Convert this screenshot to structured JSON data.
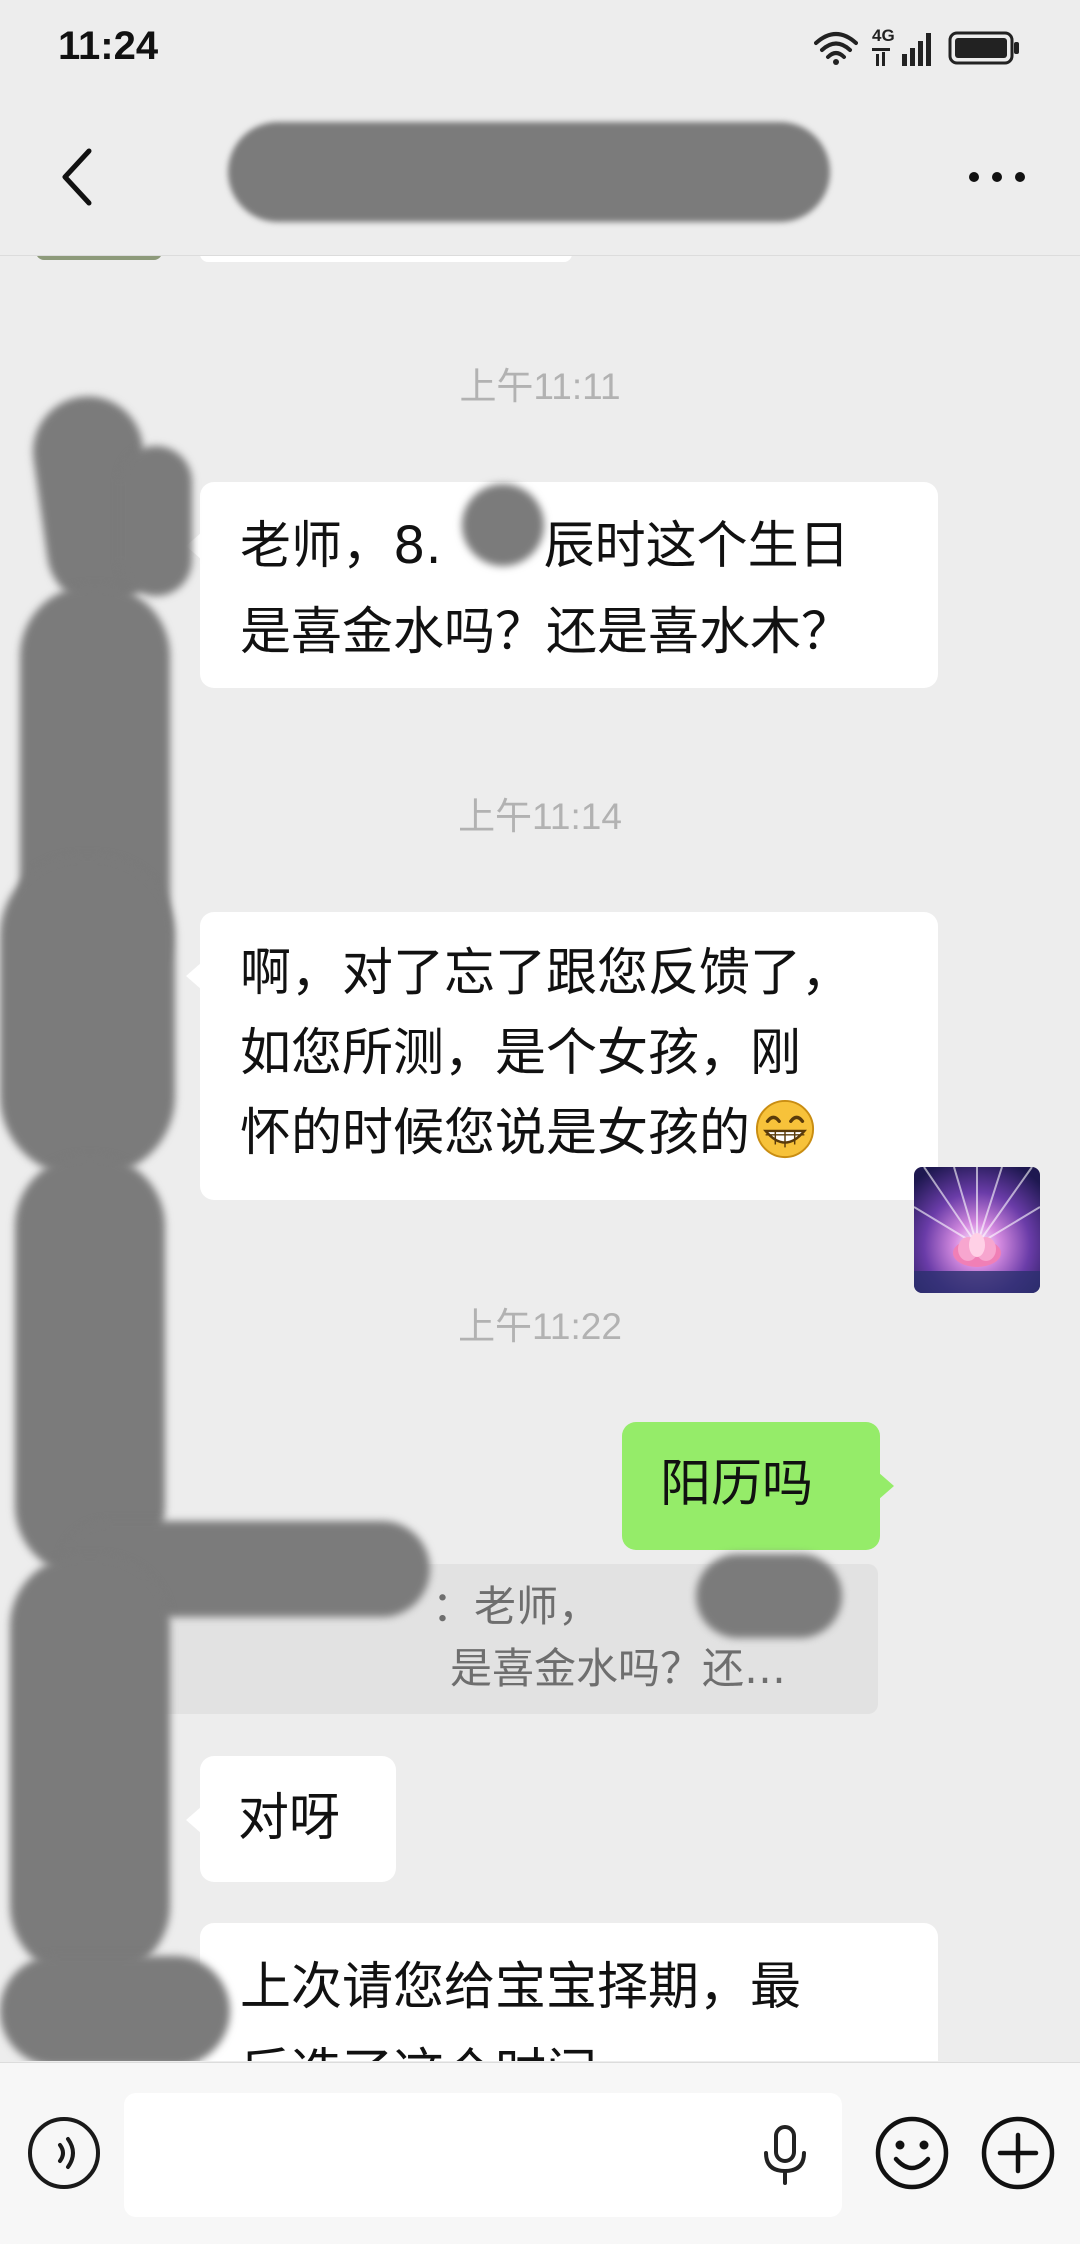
{
  "status_bar": {
    "time": "11:24",
    "network": "4G",
    "icons": [
      "wifi-icon",
      "signal-icon",
      "battery-icon"
    ]
  },
  "nav": {
    "back_icon": "chevron-left-icon",
    "more_icon": "more-dots-icon"
  },
  "messages": [
    {
      "kind": "timestamp",
      "text": "上午11:11"
    },
    {
      "kind": "incoming",
      "lines": [
        "老师，8.　　辰时这个生日",
        "是喜金水吗？还是喜水木？"
      ]
    },
    {
      "kind": "timestamp",
      "text": "上午11:14"
    },
    {
      "kind": "incoming",
      "lines": [
        "啊，对了忘了跟您反馈了，",
        "如您所测，是个女孩，刚",
        "怀的时候您说是女孩的"
      ],
      "emoji": "grinning-face-emoji"
    },
    {
      "kind": "timestamp",
      "text": "上午11:22"
    },
    {
      "kind": "outgoing",
      "text": "阳历吗"
    },
    {
      "kind": "quote",
      "lines": [
        "：老师，",
        "是喜金水吗？还…"
      ]
    },
    {
      "kind": "incoming",
      "text": "对呀"
    },
    {
      "kind": "incoming",
      "lines": [
        "上次请您给宝宝择期，最",
        "后选了这个时间"
      ]
    }
  ],
  "input_bar": {
    "placeholder": "",
    "voice_icon": "voice-mode-icon",
    "mic_icon": "microphone-icon",
    "emoji_icon": "emoji-icon",
    "plus_icon": "plus-icon"
  },
  "colors": {
    "background": "#ededed",
    "incoming_bubble": "#ffffff",
    "outgoing_bubble": "#95ec69",
    "timestamp": "#b2b2b2"
  }
}
